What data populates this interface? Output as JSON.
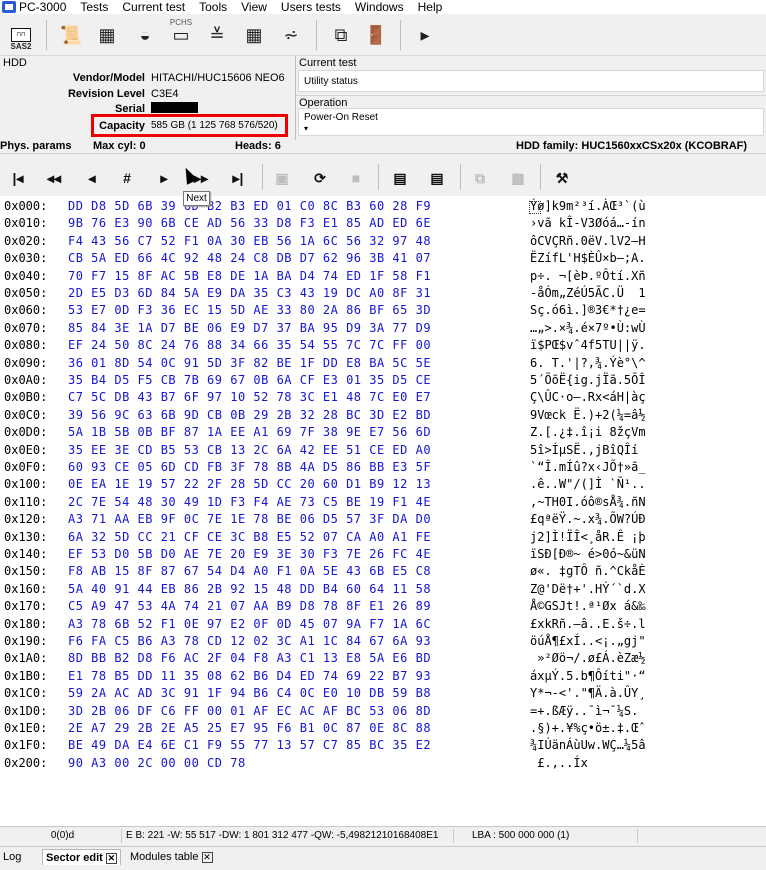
{
  "menu": {
    "app": "PC-3000",
    "items": [
      "Tests",
      "Current test",
      "Tools",
      "View",
      "Users tests",
      "Windows",
      "Help"
    ]
  },
  "toolbar": {
    "sas2_label": "SAS2",
    "pchs_label": "PCHS"
  },
  "hdd": {
    "title": "HDD",
    "vendor_label": "Vendor/Model",
    "vendor_value": "HITACHI/HUC15606  NEO6",
    "revision_label": "Revision Level",
    "revision_value": "C3E4",
    "serial_label": "Serial",
    "capacity_label": "Capacity",
    "capacity_value": "585 GB (1 125 768 576/520)"
  },
  "current_test": {
    "title": "Current test",
    "value": "Utility status"
  },
  "operation": {
    "title": "Operation",
    "value": "Power-On Reset"
  },
  "params": {
    "phys": "Phys. params",
    "maxcyl": "Max cyl: 0",
    "heads": "Heads: 6",
    "family": "HDD family: HUC1560xxCSx20x (KCOBRAF)"
  },
  "tooltip": "Next",
  "hex": {
    "rows": [
      {
        "off": "0x000:",
        "bytes": "DD D8 5D 6B 39 6D B2 B3 ED 01 C0 8C B3 60 28 F9",
        "ascii": "Ýø]k9m²³í.ÀŒ³`(ù"
      },
      {
        "off": "0x010:",
        "bytes": "9B 76 E3 90 6B CE AD 56 33 D8 F3 E1 85 AD ED 6E",
        "ascii": "›vã kÎ-V3Øóá…-ín"
      },
      {
        "off": "0x020:",
        "bytes": "F4 43 56 C7 52 F1 0A 30 EB 56 1A 6C 56 32 97 48",
        "ascii": "ôCVÇRñ.0ëV.lV2—H"
      },
      {
        "off": "0x030:",
        "bytes": "CB 5A ED 66 4C 92 48 24 C8 DB D7 62 96 3B 41 07",
        "ascii": "ËZífL'H$ÈÛ×b–;A."
      },
      {
        "off": "0x040:",
        "bytes": "70 F7 15 8F AC 5B E8 DE 1A BA D4 74 ED 1F 58 F1",
        "ascii": "p÷. ¬[èÞ.ºÔtí.Xñ"
      },
      {
        "off": "0x050:",
        "bytes": "2D E5 D3 6D 84 5A E9 DA 35 C3 43 19 DC A0 8F 31",
        "ascii": "-åÓm„ZéÚ5ÃC.Ü  1"
      },
      {
        "off": "0x060:",
        "bytes": "53 E7 0D F3 36 EC 15 5D AE 33 80 2A 86 BF 65 3D",
        "ascii": "Sç.ó6ì.]®3€*†¿e="
      },
      {
        "off": "0x070:",
        "bytes": "85 84 3E 1A D7 BE 06 E9 D7 37 BA 95 D9 3A 77 D9",
        "ascii": "…„>.×¾.é×7º•Ù:wÙ"
      },
      {
        "off": "0x080:",
        "bytes": "EF 24 50 8C 24 76 88 34 66 35 54 55 7C 7C FF 00",
        "ascii": "ï$PŒ$vˆ4f5TU||ÿ."
      },
      {
        "off": "0x090:",
        "bytes": "36 01 8D 54 0C 91 5D 3F 82 BE 1F DD E8 BA 5C 5E",
        "ascii": "6. T.'|?,¾.Ýè°\\^"
      },
      {
        "off": "0x0A0:",
        "bytes": "35 B4 D5 F5 CB 7B 69 67 0B 6A CF E3 01 35 D5 CE",
        "ascii": "5´ÕõË{ig.jÏã.5ÕÎ"
      },
      {
        "off": "0x0B0:",
        "bytes": "C7 5C DB 43 B7 6F 97 10 52 78 3C E1 48 7C E0 E7",
        "ascii": "Ç\\ÛC·o—.Rx<áH|àç"
      },
      {
        "off": "0x0C0:",
        "bytes": "39 56 9C 63 6B 9D CB 0B 29 2B 32 28 BC 3D E2 BD",
        "ascii": "9Vœck Ë.)+2(¼=â½"
      },
      {
        "off": "0x0D0:",
        "bytes": "5A 1B 5B 0B BF 87 1A EE A1 69 7F 38 9E E7 56 6D",
        "ascii": "Z.[.¿‡.î¡i 8žçVm"
      },
      {
        "off": "0x0E0:",
        "bytes": "35 EE 3E CD B5 53 CB 13 2C 6A 42 EE 51 CE ED A0",
        "ascii": "5î>ÍµSË.,jBîQÎí "
      },
      {
        "off": "0x0F0:",
        "bytes": "60 93 CE 05 6D CD FB 3F 78 8B 4A D5 86 BB E3 5F",
        "ascii": "`“Î.mÍû?x‹JÕ†»ã_"
      },
      {
        "off": "0x100:",
        "bytes": "0E EA 1E 19 57 22 2F 28 5D CC 20 60 D1 B9 12 13",
        "ascii": ".ê..W\"/(]Ì `Ñ¹.."
      },
      {
        "off": "0x110:",
        "bytes": "2C 7E 54 48 30 49 1D F3 F4 AE 73 C5 BE 19 F1 4E",
        "ascii": ",~TH0I.óô®sÅ¾.ñN"
      },
      {
        "off": "0x120:",
        "bytes": "A3 71 AA EB 9F 0C 7E 1E 78 BE 06 D5 57 3F DA D0",
        "ascii": "£qªëŸ.~.x¾.ÕW?ÚÐ"
      },
      {
        "off": "0x130:",
        "bytes": "6A 32 5D CC 21 CF CE 3C B8 E5 52 07 CA A0 A1 FE",
        "ascii": "j2]Ì!ÏÎ<¸åR.Ê ¡þ"
      },
      {
        "off": "0x140:",
        "bytes": "EF 53 D0 5B D0 AE 7E 20 E9 3E 30 F3 7E 26 FC 4E",
        "ascii": "ïSÐ[Ð®~ é>0ó~&üN"
      },
      {
        "off": "0x150:",
        "bytes": "F8 AB 15 8F 87 67 54 D4 A0 F1 0A 5E 43 6B E5 C8",
        "ascii": "ø«. ‡gTÔ ñ.^CkåÈ"
      },
      {
        "off": "0x160:",
        "bytes": "5A 40 91 44 EB 86 2B 92 15 48 DD B4 60 64 11 58",
        "ascii": "Z@'Dë†+'.HÝ´`d.X"
      },
      {
        "off": "0x170:",
        "bytes": "C5 A9 47 53 4A 74 21 07 AA B9 D8 78 8F E1 26 89",
        "ascii": "Å©GSJt!.ª¹Øx á&‰"
      },
      {
        "off": "0x180:",
        "bytes": "A3 78 6B 52 F1 0E 97 E2 0F 0D 45 07 9A F7 1A 6C",
        "ascii": "£xkRñ.—â..E.š÷.l"
      },
      {
        "off": "0x190:",
        "bytes": "F6 FA C5 B6 A3 78 CD 12 02 3C A1 1C 84 67 6A 93",
        "ascii": "öúÅ¶£xÍ..<¡.„gj\""
      },
      {
        "off": "0x1A0:",
        "bytes": "8D BB B2 D8 F6 AC 2F 04 F8 A3 C1 13 E8 5A E6 BD",
        "ascii": " »²Øö¬/.ø£Á.èZæ½"
      },
      {
        "off": "0x1B0:",
        "bytes": "E1 78 B5 DD 11 35 08 62 B6 D4 ED 74 69 22 B7 93",
        "ascii": "áxµÝ.5.b¶Ôíti\"·“"
      },
      {
        "off": "0x1C0:",
        "bytes": "59 2A AC AD 3C 91 1F 94 B6 C4 0C E0 10 DB 59 B8",
        "ascii": "Y*¬-<'.\"¶Ä.à.ÛY¸"
      },
      {
        "off": "0x1D0:",
        "bytes": "3D 2B 06 DF C6 FF 00 01 AF EC AC AF BC 53 06 8D",
        "ascii": "=+.ßÆÿ..¯ì¬¯¼S. "
      },
      {
        "off": "0x1E0:",
        "bytes": "2E A7 29 2B 2E A5 25 E7 95 F6 B1 0C 87 0E 8C 88",
        "ascii": ".§)+.¥%ç•ö±.‡.Œˆ"
      },
      {
        "off": "0x1F0:",
        "bytes": "BE 49 DA E4 6E C1 F9 55 77 13 57 C7 85 BC 35 E2",
        "ascii": "¾IÚänÁùUw.WÇ…¼5â"
      },
      {
        "off": "0x200:",
        "bytes": "90 A3 00 2C 00 00 CD 78",
        "ascii": " £.,..Íx"
      }
    ]
  },
  "status": {
    "pos": "0(0)d",
    "values": "E B: 221 -W: 55 517 -DW: 1 801 312 477 -QW: -5,49821210168408E1",
    "lba": "LBA : 500 000 000 (1)"
  },
  "tabs": {
    "log": "Log",
    "sector": "Sector edit",
    "modules": "Modules table"
  }
}
